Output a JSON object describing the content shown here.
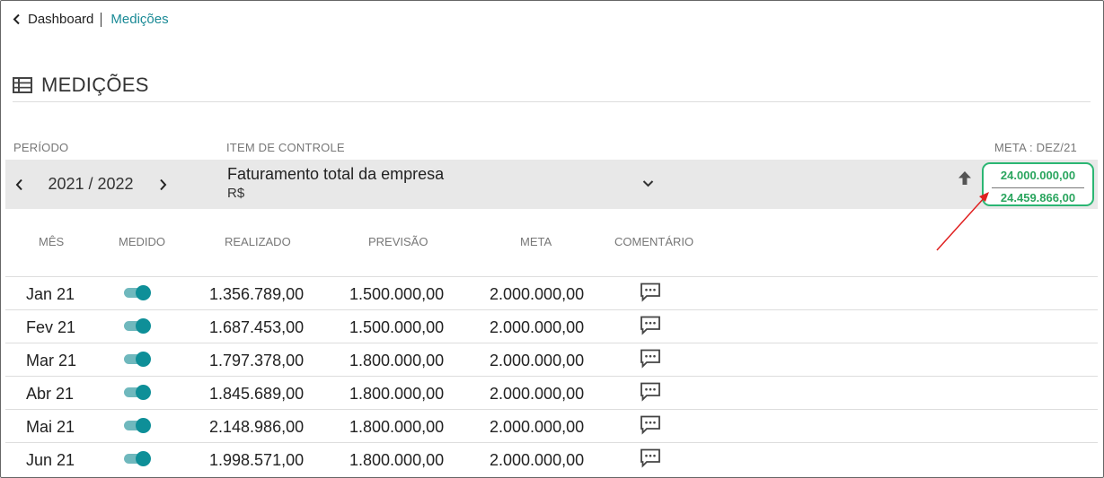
{
  "breadcrumb": {
    "back_label": "Dashboard",
    "current": "Medições"
  },
  "page": {
    "title": "MEDIÇÕES"
  },
  "labels": {
    "periodo": "PERÍODO",
    "item_controle": "ITEM DE CONTROLE",
    "meta_header": "META : DEZ/21"
  },
  "control": {
    "period": "2021 / 2022",
    "item_title": "Faturamento total da empresa",
    "item_unit": "R$",
    "meta_value": "24.000.000,00",
    "meta_actual": "24.459.866,00"
  },
  "columns": [
    "MÊS",
    "MEDIDO",
    "REALIZADO",
    "PREVISÃO",
    "META",
    "COMENTÁRIO"
  ],
  "rows": [
    {
      "mes": "Jan 21",
      "medido": true,
      "realizado": "1.356.789,00",
      "previsao": "1.500.000,00",
      "meta": "2.000.000,00"
    },
    {
      "mes": "Fev 21",
      "medido": true,
      "realizado": "1.687.453,00",
      "previsao": "1.500.000,00",
      "meta": "2.000.000,00"
    },
    {
      "mes": "Mar 21",
      "medido": true,
      "realizado": "1.797.378,00",
      "previsao": "1.800.000,00",
      "meta": "2.000.000,00"
    },
    {
      "mes": "Abr 21",
      "medido": true,
      "realizado": "1.845.689,00",
      "previsao": "1.800.000,00",
      "meta": "2.000.000,00"
    },
    {
      "mes": "Mai 21",
      "medido": true,
      "realizado": "2.148.986,00",
      "previsao": "1.800.000,00",
      "meta": "2.000.000,00"
    },
    {
      "mes": "Jun 21",
      "medido": true,
      "realizado": "1.998.571,00",
      "previsao": "1.800.000,00",
      "meta": "2.000.000,00"
    }
  ],
  "colors": {
    "accent": "#0e8f98",
    "meta_border": "#2bb673",
    "meta_text": "#2aa55e",
    "annotation": "#e02020"
  },
  "icons": {
    "back": "chevron-left-icon",
    "title": "list-icon",
    "up": "arrow-up-icon",
    "comment": "comment-icon"
  }
}
